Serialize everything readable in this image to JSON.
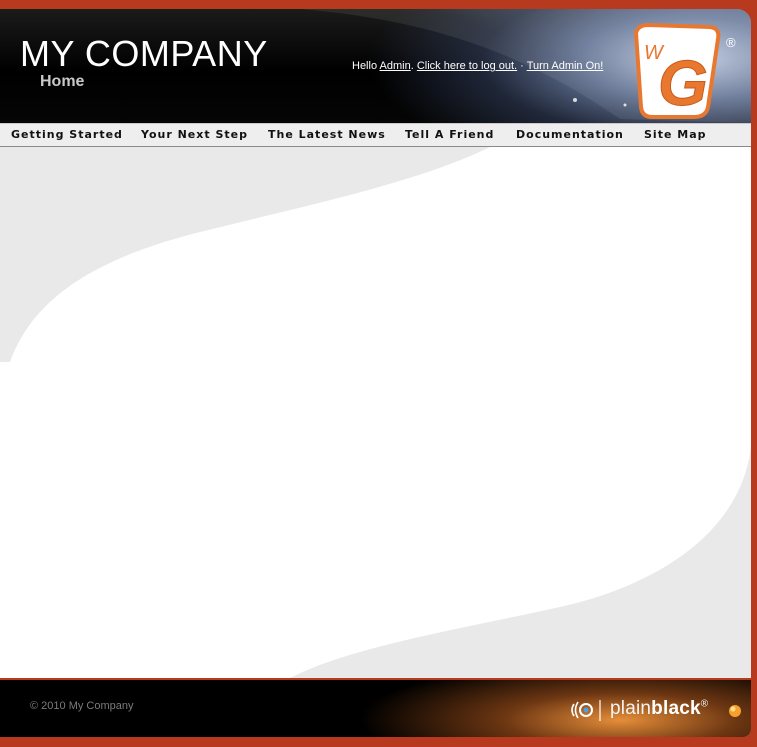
{
  "header": {
    "site_title": "MY COMPANY",
    "page_title": "Home",
    "greeting": "Hello ",
    "user_name": "Admin",
    "sep1": ". ",
    "logout_link": "Click here to log out.",
    "sep2": " · ",
    "admin_link": "Turn Admin On!",
    "logo_letters": "WG",
    "registered": "®"
  },
  "nav": {
    "items": [
      {
        "label": "Getting Started"
      },
      {
        "label": "Your Next Step"
      },
      {
        "label": "The Latest News"
      },
      {
        "label": "Tell A Friend"
      },
      {
        "label": "Documentation"
      },
      {
        "label": "Site Map"
      }
    ]
  },
  "footer": {
    "copyright": "© 2010 My Company",
    "brand_light": "plain",
    "brand_bold": "black",
    "registered": "®"
  },
  "colors": {
    "frame_red": "#b83a1e",
    "logo_orange": "#e87830",
    "footer_glow": "#f29640"
  }
}
